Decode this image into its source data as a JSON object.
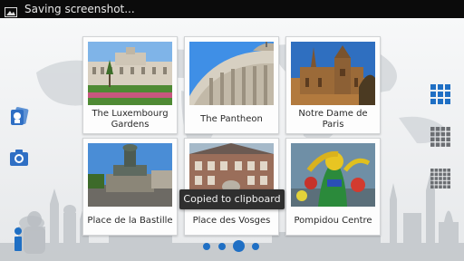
{
  "status_bar": {
    "icon": "image-icon",
    "text": "Saving screenshot..."
  },
  "tiles": [
    {
      "caption": "The Luxembourg Gardens",
      "image": "luxembourg-palace-photo"
    },
    {
      "caption": "The Pantheon",
      "image": "pantheon-dome-photo"
    },
    {
      "caption": "Notre Dame de Paris",
      "image": "notre-dame-photo"
    },
    {
      "caption": "Place de la Bastille",
      "image": "bastille-column-photo"
    },
    {
      "caption": "Place des Vosges",
      "image": "vosges-building-photo"
    },
    {
      "caption": "Pompidou Centre",
      "image": "pompidou-sculpture-photo"
    }
  ],
  "left_controls": [
    {
      "icon": "photo-album-icon"
    },
    {
      "icon": "camera-icon"
    },
    {
      "icon": "info-icon"
    }
  ],
  "right_controls": [
    {
      "icon": "grid-3x3-icon",
      "state": "selected"
    },
    {
      "icon": "grid-4x4-icon",
      "state": "normal"
    },
    {
      "icon": "grid-5x5-icon",
      "state": "normal"
    }
  ],
  "toast": {
    "text": "Copied to clipboard"
  },
  "pager": {
    "page_count": 4,
    "current_page": 3
  },
  "colors": {
    "accent_blue": "#1f6fc4",
    "status_bar": "#0b0b0b",
    "toast_bg": "#2f2f2f",
    "tile_bg": "#fdfdfd"
  }
}
